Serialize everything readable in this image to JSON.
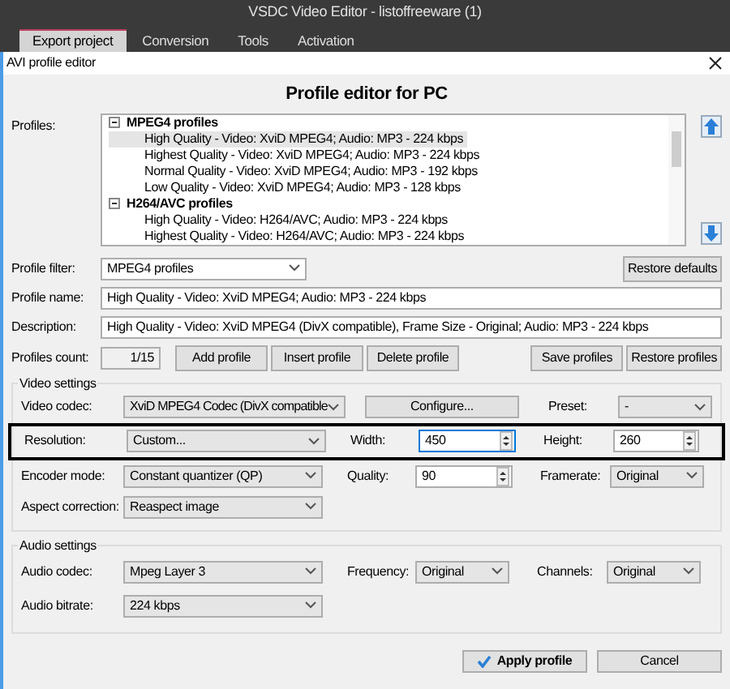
{
  "app_title": "VSDC Video Editor - listoffreeware (1)",
  "tabs": [
    {
      "label": "Export project",
      "selected": true
    },
    {
      "label": "Conversion",
      "selected": false
    },
    {
      "label": "Tools",
      "selected": false
    },
    {
      "label": "Activation",
      "selected": false
    }
  ],
  "dialog": {
    "title": "AVI profile editor",
    "heading": "Profile editor for PC"
  },
  "profiles": {
    "label": "Profiles:",
    "groups": [
      {
        "name": "MPEG4 profiles",
        "expanded": true,
        "children": [
          {
            "label": "High Quality - Video: XviD MPEG4; Audio: MP3 - 224 kbps",
            "selected": true
          },
          {
            "label": "Highest Quality - Video: XviD MPEG4; Audio: MP3 - 224 kbps",
            "selected": false
          },
          {
            "label": "Normal Quality - Video: XviD MPEG4; Audio: MP3 - 192 kbps",
            "selected": false
          },
          {
            "label": "Low Quality - Video: XviD MPEG4; Audio: MP3 - 128 kbps",
            "selected": false
          }
        ]
      },
      {
        "name": "H264/AVC profiles",
        "expanded": true,
        "children": [
          {
            "label": "High Quality - Video: H264/AVC; Audio: MP3 - 224 kbps",
            "selected": false
          },
          {
            "label": "Highest Quality - Video: H264/AVC; Audio: MP3 - 224 kbps",
            "selected": false
          }
        ]
      }
    ]
  },
  "profile_filter": {
    "label": "Profile filter:",
    "value": "MPEG4 profiles"
  },
  "restore_defaults": "Restore defaults",
  "profile_name": {
    "label": "Profile name:",
    "value": "High Quality - Video: XviD MPEG4; Audio: MP3 - 224 kbps"
  },
  "description": {
    "label": "Description:",
    "value": "High Quality - Video: XviD MPEG4 (DivX compatible), Frame Size - Original; Audio: MP3 - 224 kbps"
  },
  "profiles_count": {
    "label": "Profiles count:",
    "value": "1/15"
  },
  "profile_buttons": [
    "Add profile",
    "Insert profile",
    "Delete profile"
  ],
  "file_buttons": [
    "Save profiles",
    "Restore profiles"
  ],
  "video_settings": {
    "title": "Video settings",
    "video_codec": {
      "label": "Video codec:",
      "value": "XviD MPEG4 Codec (DivX compatible"
    },
    "configure": "Configure...",
    "preset": {
      "label": "Preset:",
      "value": "-"
    },
    "resolution": {
      "label": "Resolution:",
      "value": "Custom..."
    },
    "width": {
      "label": "Width:",
      "value": "450",
      "focused": true
    },
    "height": {
      "label": "Height:",
      "value": "260",
      "focused": false
    },
    "encoder_mode": {
      "label": "Encoder mode:",
      "value": "Constant quantizer (QP)"
    },
    "quality": {
      "label": "Quality:",
      "value": "90",
      "focused": false
    },
    "framerate": {
      "label": "Framerate:",
      "value": "Original"
    },
    "aspect_correction": {
      "label": "Aspect correction:",
      "value": "Reaspect image"
    }
  },
  "audio_settings": {
    "title": "Audio settings",
    "audio_codec": {
      "label": "Audio codec:",
      "value": "Mpeg Layer 3"
    },
    "frequency": {
      "label": "Frequency:",
      "value": "Original"
    },
    "channels": {
      "label": "Channels:",
      "value": "Original"
    },
    "audio_bitrate": {
      "label": "Audio bitrate:",
      "value": "224 kbps"
    }
  },
  "footer_buttons": [
    {
      "label": "Apply profile",
      "kind": "primary"
    },
    {
      "label": "Cancel",
      "kind": "plain"
    }
  ]
}
